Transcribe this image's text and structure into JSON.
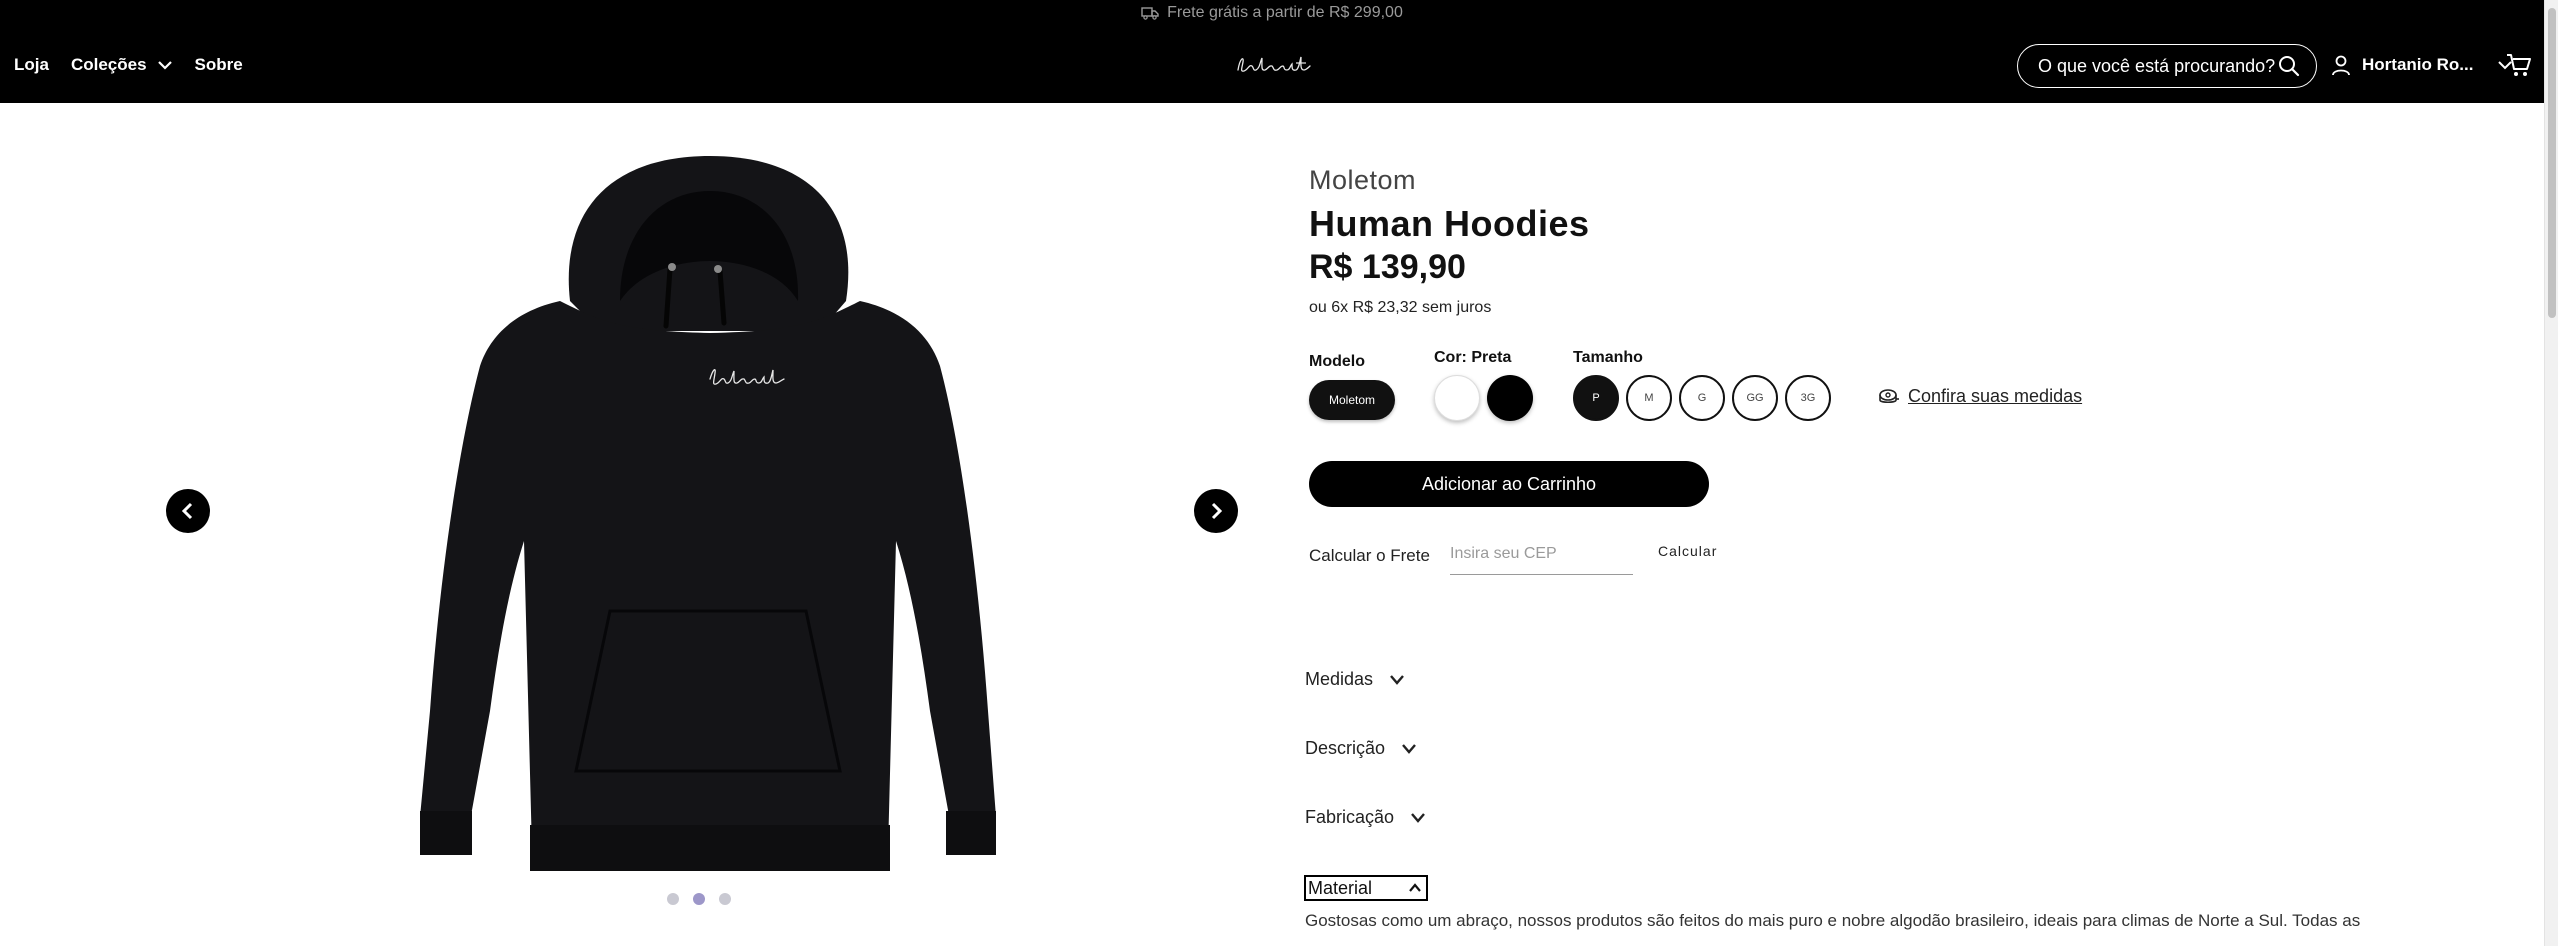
{
  "announcement": {
    "text": "Frete grátis a partir de R$ 299,00",
    "icon": "truck-icon"
  },
  "nav": {
    "items": [
      {
        "label": "Loja"
      },
      {
        "label": "Coleções",
        "has_dropdown": true
      },
      {
        "label": "Sobre"
      }
    ]
  },
  "logo": {
    "text": "labsit"
  },
  "search": {
    "placeholder": "O que você está procurando?",
    "icon": "search-icon"
  },
  "account": {
    "name": "Hortanio Ro...",
    "icon": "user-icon"
  },
  "cart": {
    "icon": "cart-icon"
  },
  "gallery": {
    "image": "black-hoodie",
    "dots": 3,
    "active_dot": 2
  },
  "product": {
    "category": "Moletom",
    "title": "Human Hoodies",
    "price": "R$ 139,90",
    "installments": "ou 6x R$ 23,32 sem juros",
    "model_label": "Modelo",
    "model_value": "Moletom",
    "color_label": "Cor: Preta",
    "colors": [
      "#ffffff",
      "#000000"
    ],
    "size_label": "Tamanho",
    "sizes": [
      "P",
      "M",
      "G",
      "GG",
      "3G"
    ],
    "selected_size": "P",
    "measures_link": "Confira suas medidas",
    "add_to_cart": "Adicionar ao Carrinho",
    "shipping_label": "Calcular o Frete",
    "cep_placeholder": "Insira seu CEP",
    "calc_button": "Calcular"
  },
  "accordions": {
    "medidas": "Medidas",
    "descricao": "Descrição",
    "fabricacao": "Fabricação",
    "material": "Material",
    "material_text": "Gostosas como um abraço, nossos produtos são feitos do mais puro e nobre algodão brasileiro, ideais para climas de Norte a Sul. Todas as"
  },
  "colors": {
    "header_bg": "#000000",
    "accent": "#000000",
    "active_dot": "#9d97c9"
  }
}
